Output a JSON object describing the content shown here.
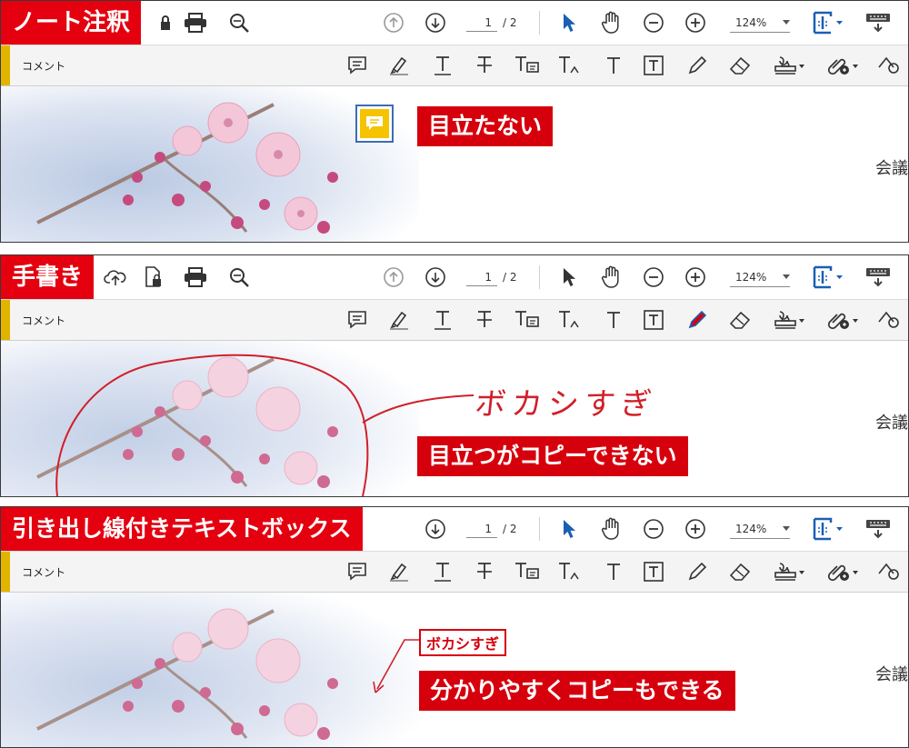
{
  "panels": [
    {
      "title": "ノート注釈",
      "page_current": "1",
      "page_total": "/ 2",
      "zoom": "124%",
      "comment_label": "コメント",
      "callout": "目立たない",
      "doc_text": "会議"
    },
    {
      "title": "手書き",
      "page_current": "1",
      "page_total": "/ 2",
      "zoom": "124%",
      "comment_label": "コメント",
      "handwriting": "ボカシすぎ",
      "callout": "目立つがコピーできない",
      "doc_text": "会議"
    },
    {
      "title": "引き出し線付きテキストボックス",
      "page_current": "1",
      "page_total": "/ 2",
      "zoom": "124%",
      "comment_label": "コメント",
      "textbox": "ボカシすぎ",
      "callout": "分かりやすくコピーもできる",
      "doc_text": "会議"
    }
  ],
  "colors": {
    "label_red": "#e4000f",
    "accent_yellow": "#e1b400",
    "active_blue": "#1a5fb4",
    "note_yellow": "#f5c300"
  },
  "icons": [
    "upload-icon",
    "lock-file-icon",
    "print-icon",
    "search-zoom-icon",
    "page-up-icon",
    "page-down-icon",
    "select-arrow-icon",
    "hand-icon",
    "zoom-out-icon",
    "zoom-in-icon",
    "fit-page-icon",
    "keyboard-icon",
    "sticky-note-icon",
    "highlighter-icon",
    "underline-text-icon",
    "strikethrough-text-icon",
    "replace-text-icon",
    "insert-text-icon",
    "add-text-icon",
    "textbox-icon",
    "pencil-icon",
    "eraser-icon",
    "stamp-icon",
    "attach-icon",
    "shapes-icon"
  ]
}
